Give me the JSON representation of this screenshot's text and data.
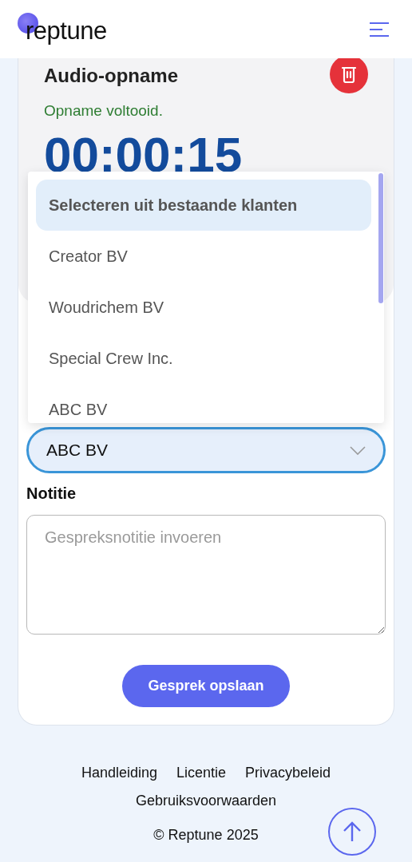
{
  "header": {
    "logo": "reptune"
  },
  "recording": {
    "title": "Audio-opname",
    "status": "Opname voltooid.",
    "timer": "00:00:15"
  },
  "client_dropdown": {
    "options": [
      {
        "label": "Selecteren uit bestaande klanten",
        "selected": true
      },
      {
        "label": "Creator BV",
        "selected": false
      },
      {
        "label": "Woudrichem BV",
        "selected": false
      },
      {
        "label": "Special Crew Inc.",
        "selected": false
      },
      {
        "label": "ABC BV",
        "selected": false
      }
    ]
  },
  "client_field": {
    "value": "ABC BV"
  },
  "note": {
    "label": "Notitie",
    "placeholder": "Gespreksnotitie invoeren"
  },
  "save_button": "Gesprek opslaan",
  "footer": {
    "links": [
      "Handleiding",
      "Licentie",
      "Privacybeleid",
      "Gebruiksvoorwaarden"
    ],
    "copyright": "© Reptune 2025"
  }
}
